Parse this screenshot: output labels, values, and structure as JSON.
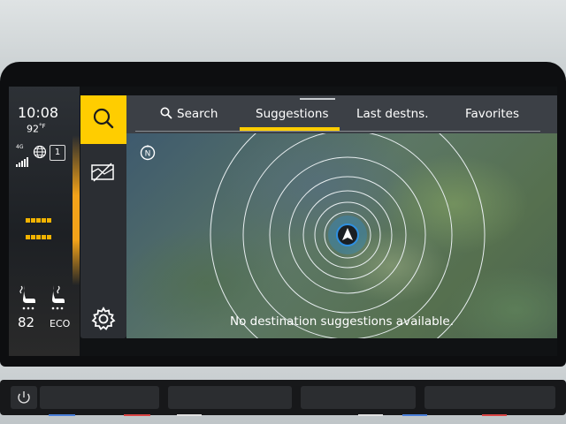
{
  "status": {
    "time": "10:08",
    "temperature": "92",
    "temperature_unit": "°F",
    "network": "4G",
    "profile_number": "1",
    "fan_level": "82",
    "mode": "ECO"
  },
  "tabs": [
    {
      "label": "Search",
      "icon": "search-icon"
    },
    {
      "label": "Suggestions",
      "active": true
    },
    {
      "label": "Last destns."
    },
    {
      "label": "Favorites"
    }
  ],
  "map": {
    "message": "No destination suggestions available.",
    "compass_label": "N"
  },
  "colors": {
    "accent": "#ffcd00",
    "ambient_orange": "#f2a21a",
    "panel": "#2e3237"
  }
}
